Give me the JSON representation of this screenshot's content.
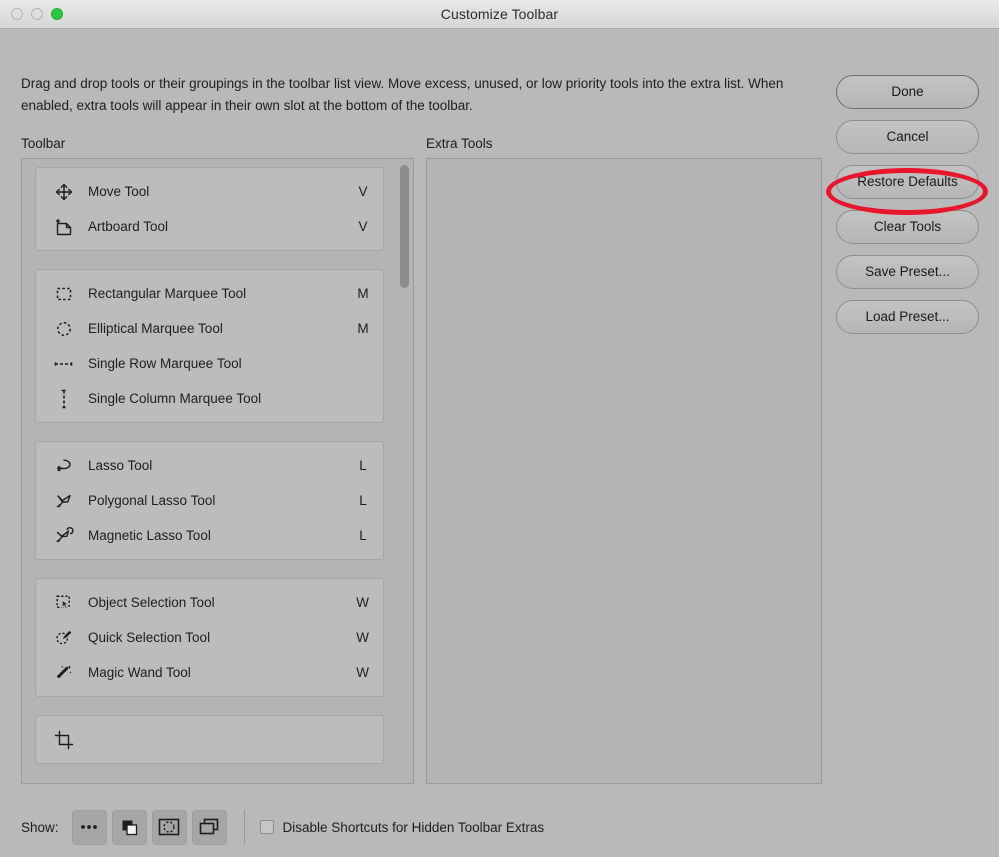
{
  "window": {
    "title": "Customize Toolbar",
    "traffic_lights": [
      "close-button",
      "minimize-button",
      "zoom-button"
    ]
  },
  "description": "Drag and drop tools or their groupings in the toolbar list view. Move excess, unused, or low priority tools into the extra list. When enabled, extra tools will appear in their own slot at the bottom of the toolbar.",
  "columns": {
    "toolbar_label": "Toolbar",
    "extra_label": "Extra Tools"
  },
  "toolbar_groups": [
    {
      "tools": [
        {
          "name": "Move Tool",
          "shortcut": "V",
          "icon": "move-tool-icon"
        },
        {
          "name": "Artboard Tool",
          "shortcut": "V",
          "icon": "artboard-tool-icon"
        }
      ]
    },
    {
      "tools": [
        {
          "name": "Rectangular Marquee Tool",
          "shortcut": "M",
          "icon": "rectangular-marquee-tool-icon"
        },
        {
          "name": "Elliptical Marquee Tool",
          "shortcut": "M",
          "icon": "elliptical-marquee-tool-icon"
        },
        {
          "name": "Single Row Marquee Tool",
          "shortcut": "",
          "icon": "single-row-marquee-tool-icon"
        },
        {
          "name": "Single Column Marquee Tool",
          "shortcut": "",
          "icon": "single-column-marquee-tool-icon"
        }
      ]
    },
    {
      "tools": [
        {
          "name": "Lasso Tool",
          "shortcut": "L",
          "icon": "lasso-tool-icon"
        },
        {
          "name": "Polygonal Lasso Tool",
          "shortcut": "L",
          "icon": "polygonal-lasso-tool-icon"
        },
        {
          "name": "Magnetic Lasso Tool",
          "shortcut": "L",
          "icon": "magnetic-lasso-tool-icon"
        }
      ]
    },
    {
      "tools": [
        {
          "name": "Object Selection Tool",
          "shortcut": "W",
          "icon": "object-selection-tool-icon"
        },
        {
          "name": "Quick Selection Tool",
          "shortcut": "W",
          "icon": "quick-selection-tool-icon"
        },
        {
          "name": "Magic Wand Tool",
          "shortcut": "W",
          "icon": "magic-wand-tool-icon"
        }
      ]
    },
    {
      "tools": [
        {
          "name": "",
          "shortcut": "",
          "icon": "crop-tool-icon"
        }
      ]
    }
  ],
  "extra_tools": [],
  "buttons": [
    {
      "label": "Done",
      "name": "done-button",
      "default": true
    },
    {
      "label": "Cancel",
      "name": "cancel-button",
      "default": false
    },
    {
      "label": "Restore Defaults",
      "name": "restore-defaults-button",
      "default": false
    },
    {
      "label": "Clear Tools",
      "name": "clear-tools-button",
      "default": false
    },
    {
      "label": "Save Preset...",
      "name": "save-preset-button",
      "default": false
    },
    {
      "label": "Load Preset...",
      "name": "load-preset-button",
      "default": false
    }
  ],
  "annotation": {
    "target": "Restore Defaults",
    "shape": "ellipse",
    "color": "#e8152b"
  },
  "bottom_bar": {
    "show_label": "Show:",
    "show_buttons": [
      {
        "name": "extra-tools-ellipsis-button",
        "icon": "ellipsis-icon"
      },
      {
        "name": "foreground-background-color-button",
        "icon": "color-swatches-icon"
      },
      {
        "name": "quick-mask-button",
        "icon": "quick-mask-icon"
      },
      {
        "name": "screen-mode-button",
        "icon": "screen-mode-icon"
      }
    ],
    "checkbox": {
      "label": "Disable Shortcuts for Hidden Toolbar Extras",
      "checked": false
    }
  },
  "colors": {
    "dialog_background": "#b9b9b9",
    "panel_background": "#b4b4b4",
    "group_background": "#bcbcbc",
    "accent_annotation": "#e8152b",
    "traffic_light_green": "#28c840"
  }
}
